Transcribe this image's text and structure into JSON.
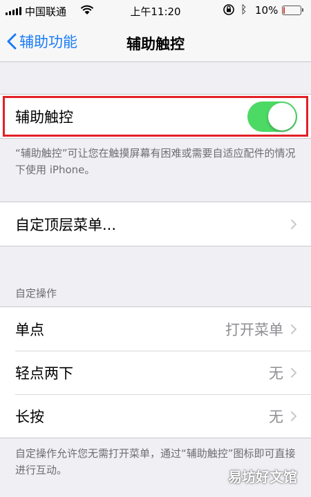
{
  "status_bar": {
    "carrier": "中国联通",
    "time": "上午11:20",
    "battery_percent": "10%",
    "battery_level": 0.1,
    "battery_color": "#e8322d",
    "icons": [
      "signal-icon",
      "wifi-icon",
      "rotation-lock-icon",
      "bluetooth-icon",
      "battery-icon"
    ]
  },
  "nav": {
    "back_label": "辅助功能",
    "title": "辅助触控"
  },
  "assistive_touch": {
    "label": "辅助触控",
    "enabled": true,
    "toggle_color": "#4cd964",
    "description": "“辅助触控”可让您在触摸屏幕有困难或需要自适应配件的情况下使用 iPhone。"
  },
  "top_menu": {
    "label": "自定顶层菜单..."
  },
  "custom_actions": {
    "header": "自定操作",
    "rows": [
      {
        "label": "单点",
        "value": "打开菜单"
      },
      {
        "label": "轻点两下",
        "value": "无"
      },
      {
        "label": "长按",
        "value": "无"
      }
    ],
    "footer": "自定操作允许您无需打开菜单，通过“辅助触控”图标即可直接进行互动。"
  },
  "watermark": "易坊好文馆",
  "accent_color": "#1a7cf5",
  "highlight_color": "#e21f26"
}
